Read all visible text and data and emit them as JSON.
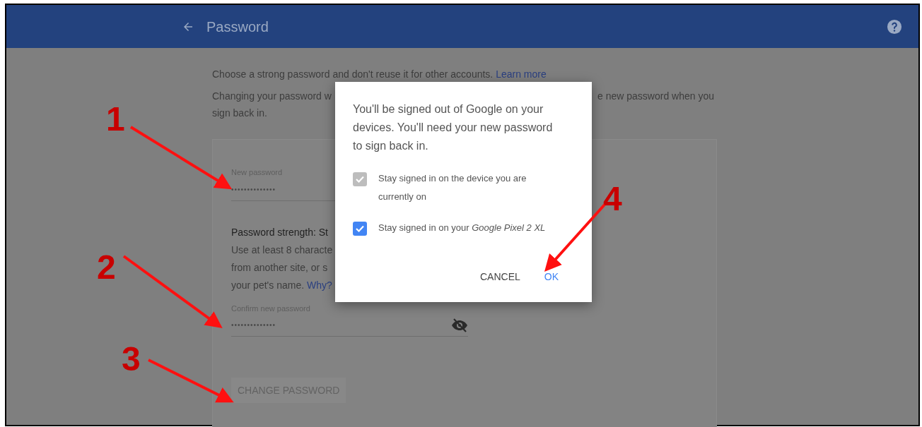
{
  "header": {
    "title": "Password"
  },
  "intro": {
    "text": "Choose a strong password and don't reuse it for other accounts.",
    "link": "Learn more"
  },
  "notice": {
    "left": "Changing your password w",
    "right": "e new password when you",
    "line2": "sign back in."
  },
  "form": {
    "new_password": {
      "label": "New password",
      "value": "••••••••••••••"
    },
    "strength": {
      "title": "Password strength: St",
      "lines": [
        "Use at least 8 characte",
        "from another site, or s"
      ],
      "last_line": "your pet's name.",
      "link": "Why?"
    },
    "confirm_password": {
      "label": "Confirm new password",
      "value": "••••••••••••••"
    },
    "submit": {
      "label": "CHANGE PASSWORD",
      "disabled": true
    }
  },
  "dialog": {
    "message": "You'll be signed out of Google on your devices. You'll need your new password to sign back in.",
    "options": [
      {
        "label": "Stay signed in on the device you are currently on",
        "checked": true,
        "disabled": true
      },
      {
        "label": "Stay signed in on your *Google Pixel 2 XL*",
        "checked": true,
        "disabled": false
      }
    ],
    "buttons": [
      {
        "label": "CANCEL",
        "kind": "secondary"
      },
      {
        "label": "OK",
        "kind": "primary"
      }
    ]
  },
  "annotations": [
    {
      "label": "1"
    },
    {
      "label": "2"
    },
    {
      "label": "3"
    },
    {
      "label": "4"
    }
  ]
}
